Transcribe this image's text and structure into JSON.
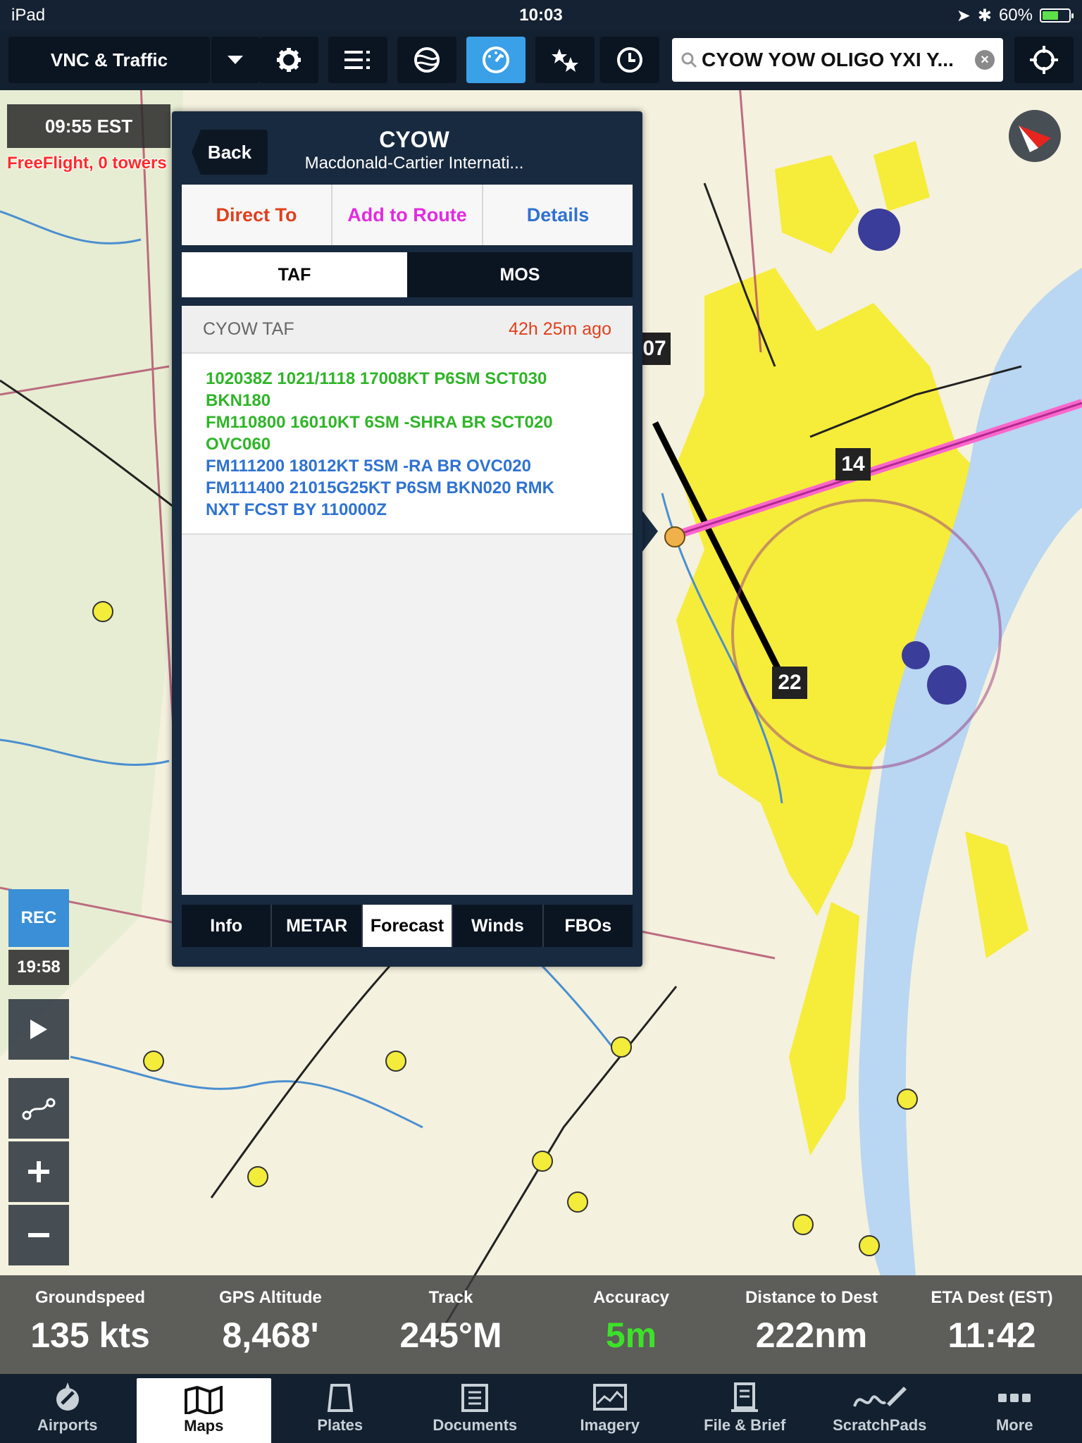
{
  "status_bar": {
    "device": "iPad",
    "time": "10:03",
    "battery": "60%",
    "battery_fraction": 0.6
  },
  "toolbar": {
    "layer_label": "VNC & Traffic",
    "search_value": "CYOW YOW OLIGO YXI Y...",
    "buttons": [
      "gear-icon",
      "list-icon",
      "globe-icon",
      "gauge-icon",
      "stars-icon",
      "clock-icon",
      "crosshair-icon"
    ],
    "active_button": "gauge-icon",
    "accent_color": "#3aa0e8"
  },
  "map": {
    "clock": "09:55 EST",
    "freeflight": "FreeFlight, 0 towers",
    "rec_label": "REC",
    "rec_time": "19:58",
    "route_color": "#ff66cc",
    "runway_labels": [
      "07",
      "14",
      "22"
    ]
  },
  "popup": {
    "back_label": "Back",
    "title": "CYOW",
    "subtitle": "Macdonald-Cartier Internati...",
    "actions": [
      {
        "label": "Direct To",
        "color": "#e0401c"
      },
      {
        "label": "Add to Route",
        "color": "#e22be0"
      },
      {
        "label": "Details",
        "color": "#2f72d1"
      }
    ],
    "segments": [
      "TAF",
      "MOS"
    ],
    "active_segment": "TAF",
    "taf_label": "CYOW TAF",
    "taf_age": "42h 25m ago",
    "taf_lines": [
      {
        "text": "102038Z 1021/1118 17008KT P6SM SCT030",
        "category": "vfr"
      },
      {
        "text": "BKN180",
        "category": "vfr"
      },
      {
        "text": "FM110800 16010KT 6SM -SHRA BR SCT020",
        "category": "vfr"
      },
      {
        "text": "OVC060",
        "category": "vfr"
      },
      {
        "text": "FM111200 18012KT 5SM -RA BR OVC020",
        "category": "mvfr"
      },
      {
        "text": "FM111400 21015G25KT P6SM BKN020 RMK",
        "category": "mvfr"
      },
      {
        "text": "NXT FCST BY 110000Z",
        "category": "mvfr"
      }
    ],
    "bottom_tabs": [
      "Info",
      "METAR",
      "Forecast",
      "Winds",
      "FBOs"
    ],
    "active_bottom_tab": "Forecast"
  },
  "instruments": [
    {
      "label": "Groundspeed",
      "value": "135 kts"
    },
    {
      "label": "GPS Altitude",
      "value": "8,468'"
    },
    {
      "label": "Track",
      "value": "245°M"
    },
    {
      "label": "Accuracy",
      "value": "5m",
      "highlight": true
    },
    {
      "label": "Distance to Dest",
      "value": "222nm"
    },
    {
      "label": "ETA Dest (EST)",
      "value": "11:42"
    }
  ],
  "tabbar": {
    "tabs": [
      {
        "label": "Airports",
        "icon": "airport-icon"
      },
      {
        "label": "Maps",
        "icon": "map-icon"
      },
      {
        "label": "Plates",
        "icon": "plates-icon"
      },
      {
        "label": "Documents",
        "icon": "documents-icon"
      },
      {
        "label": "Imagery",
        "icon": "imagery-icon"
      },
      {
        "label": "File & Brief",
        "icon": "file-brief-icon"
      },
      {
        "label": "ScratchPads",
        "icon": "scratchpad-icon"
      },
      {
        "label": "More",
        "icon": "more-icon"
      }
    ],
    "active": "Maps"
  }
}
